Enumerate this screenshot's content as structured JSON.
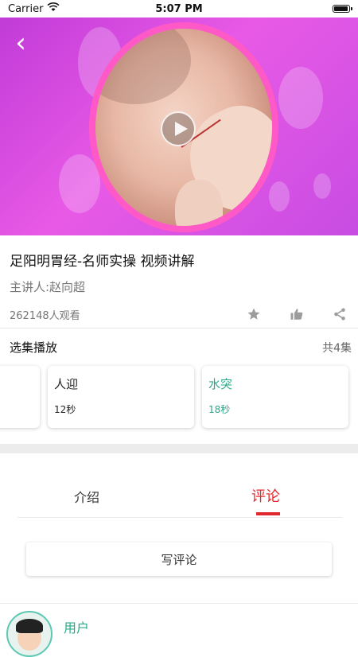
{
  "status_bar": {
    "carrier": "Carrier",
    "time": "5:07 PM",
    "battery_level": 0.85
  },
  "video": {
    "has_play_button": true,
    "has_back_button": true
  },
  "course": {
    "title": "足阳明胃经-名师实操 视频讲解",
    "lecturer": "主讲人:赵向超",
    "views": "262148人观看"
  },
  "episodes": {
    "header": "选集播放",
    "count": "共4集",
    "items": [
      {
        "name": "",
        "duration": ""
      },
      {
        "name": "人迎",
        "duration": "12秒",
        "color": "#222222"
      },
      {
        "name": "水突",
        "duration": "18秒",
        "color": "#2aa889"
      }
    ]
  },
  "tabs": [
    {
      "label": "介绍",
      "active": false
    },
    {
      "label": "评论",
      "active": true
    }
  ],
  "comment": {
    "button_label": "写评论"
  },
  "user": {
    "name": "用户"
  },
  "colors": {
    "accent": "#e0282f",
    "hero": "#d84fe4",
    "episode_selected": "#2aa889"
  },
  "icons": [
    "wifi-icon",
    "battery-icon",
    "back-icon",
    "play-icon",
    "star-icon",
    "thumbs-up-icon",
    "share-icon"
  ]
}
